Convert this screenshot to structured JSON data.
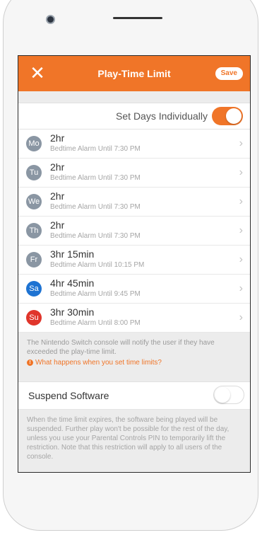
{
  "header": {
    "title": "Play-Time Limit",
    "save_label": "Save",
    "close_icon": "close-icon"
  },
  "set_days": {
    "label": "Set Days Individually",
    "enabled": true
  },
  "days": [
    {
      "abbr": "Mo",
      "time": "2hr",
      "alarm": "Bedtime Alarm Until 7:30 PM",
      "color": "#8a96a3"
    },
    {
      "abbr": "Tu",
      "time": "2hr",
      "alarm": "Bedtime Alarm Until 7:30 PM",
      "color": "#8a96a3"
    },
    {
      "abbr": "We",
      "time": "2hr",
      "alarm": "Bedtime Alarm Until 7:30 PM",
      "color": "#8a96a3"
    },
    {
      "abbr": "Th",
      "time": "2hr",
      "alarm": "Bedtime Alarm Until 7:30 PM",
      "color": "#8a96a3"
    },
    {
      "abbr": "Fr",
      "time": "3hr 15min",
      "alarm": "Bedtime Alarm Until 10:15 PM",
      "color": "#8a96a3"
    },
    {
      "abbr": "Sa",
      "time": "4hr 45min",
      "alarm": "Bedtime Alarm Until 9:45 PM",
      "color": "#1e73d2"
    },
    {
      "abbr": "Su",
      "time": "3hr 30min",
      "alarm": "Bedtime Alarm Until 8:00 PM",
      "color": "#e0352b"
    }
  ],
  "info": {
    "text": "The Nintendo Switch console will notify the user if they have exceeded the play-time limit.",
    "link": "What happens when you set time limits?"
  },
  "suspend": {
    "label": "Suspend Software",
    "enabled": false,
    "description": "When the time limit expires, the software being played will be suspended. Further play won't be possible for the rest of the day, unless you use your Parental Controls PIN to temporarily lift the restriction. Note that this restriction will apply to all users of the console."
  },
  "colors": {
    "accent": "#f07528",
    "saturday": "#1e73d2",
    "sunday": "#e0352b",
    "weekday": "#8a96a3"
  }
}
